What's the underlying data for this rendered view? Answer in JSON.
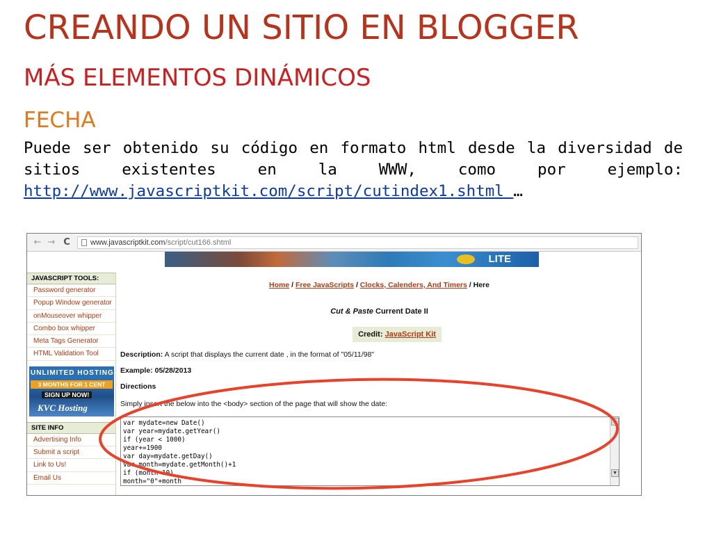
{
  "slide": {
    "title": "CREANDO UN SITIO EN BLOGGER",
    "subtitle": "MÁS ELEMENTOS DINÁMICOS",
    "section": "FECHA",
    "para_line1": "Puede ser obtenido su código en formato html desde la diversidad de",
    "para_line2_words": [
      "sitios",
      "existentes",
      "en",
      "la",
      "WWW,",
      "como",
      "por",
      "ejemplo:"
    ],
    "link": "http://www.javascriptkit.com/script/cutindex1.shtml ",
    "ellipsis": "…"
  },
  "browser": {
    "back_glyph": "←",
    "forward_glyph": "→",
    "reload_glyph": "C",
    "url_host": "www.javascriptkit.com",
    "url_path": "/script/cut166.shtml"
  },
  "banner": {
    "label": "LITE"
  },
  "sidebar": {
    "tools_heading": "JAVASCRIPT TOOLS:",
    "tools": [
      "Password generator",
      "Popup Window generator",
      "onMouseover whipper",
      "Combo box whipper",
      "Meta Tags Generator",
      "HTML Validation Tool"
    ],
    "ad": {
      "line1": "UNLIMITED HOSTING",
      "line2": "3 MONTHS FOR 1 CENT",
      "line3": "SIGN UP NOW!",
      "line4": "KVC Hosting"
    },
    "info_heading": "SITE INFO",
    "info": [
      "Advertising Info",
      "Submit a script",
      "Link to Us!",
      "Email Us"
    ]
  },
  "content": {
    "crumb_home": "Home",
    "crumb_sep": " / ",
    "crumb_free": "Free JavaScripts",
    "crumb_clocks": "Clocks, Calenders, And Timers",
    "crumb_here": "Here",
    "heading_italic": "Cut & Paste",
    "heading_rest": " Current Date II",
    "credit_label": "Credit: ",
    "credit_link": "JavaScript Kit",
    "desc_label": "Description:",
    "desc_text": " A script that displays the current date , in the format of \"05/11/98\"",
    "example": "Example: 05/28/2013",
    "directions": "Directions",
    "simply": "Simply insert the below into the <body> section of the page that will show the date:",
    "code": [
      "var mydate=new Date()",
      "var year=mydate.getYear()",
      "if (year < 1000)",
      "year+=1900",
      "var day=mydate.getDay()",
      "var month=mydate.getMonth()+1",
      "if (month<10)",
      "month=\"0\"+month"
    ]
  },
  "colors": {
    "title": "#b8321c",
    "subtitle": "#cc1e1e",
    "section": "#e07a1e",
    "link": "#0b3aa8",
    "oval": "#e8432a"
  }
}
